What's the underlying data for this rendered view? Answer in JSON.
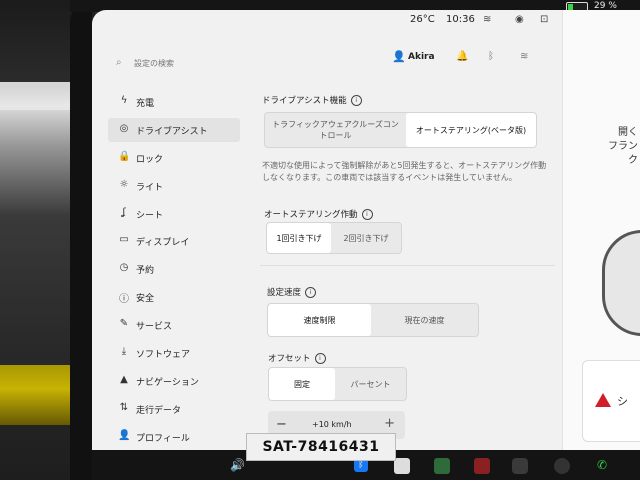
{
  "status_bar": {
    "temperature": "26°C",
    "time": "10:36",
    "battery_percent": "29 %",
    "battery_level": 0.29
  },
  "header": {
    "search_placeholder": "設定の検索",
    "user_name": "Akira"
  },
  "sidebar": {
    "items": [
      {
        "label": "充電",
        "icon": "bolt-icon",
        "glyph": "ϟ"
      },
      {
        "label": "ドライブアシスト",
        "icon": "steering-wheel-icon",
        "glyph": "◎",
        "active": true
      },
      {
        "label": "ロック",
        "icon": "lock-icon",
        "glyph": "🔒"
      },
      {
        "label": "ライト",
        "icon": "light-icon",
        "glyph": "☼"
      },
      {
        "label": "シート",
        "icon": "seat-icon",
        "glyph": "ʆ"
      },
      {
        "label": "ディスプレイ",
        "icon": "display-icon",
        "glyph": "▭"
      },
      {
        "label": "予約",
        "icon": "clock-icon",
        "glyph": "◷"
      },
      {
        "label": "安全",
        "icon": "safety-icon",
        "glyph": "ⓘ"
      },
      {
        "label": "サービス",
        "icon": "wrench-icon",
        "glyph": "✎"
      },
      {
        "label": "ソフトウェア",
        "icon": "download-icon",
        "glyph": "⤓"
      },
      {
        "label": "ナビゲーション",
        "icon": "navigation-icon",
        "glyph": "▲"
      },
      {
        "label": "走行データ",
        "icon": "trip-icon",
        "glyph": "⇅"
      },
      {
        "label": "プロフィール",
        "icon": "profile-icon",
        "glyph": "👤"
      }
    ]
  },
  "main": {
    "drive_assist": {
      "title": "ドライブアシスト機能",
      "options": [
        "トラフィックアウェアクルーズコントロール",
        "オートステアリング(ベータ版)"
      ],
      "selected": 1,
      "description": "不適切な使用によって強制解除があと5回発生すると、オートステアリング作動しなくなります。この車両では該当するイベントは発生していません。"
    },
    "autosteer_activation": {
      "title": "オートステアリング作動",
      "options": [
        "1回引き下げ",
        "2回引き下げ"
      ],
      "selected": 0
    },
    "set_speed": {
      "title": "設定速度",
      "options": [
        "速度制限",
        "現在の速度"
      ],
      "selected": 0
    },
    "offset": {
      "title": "オフセット",
      "options": [
        "固定",
        "パーセント"
      ],
      "selected": 0,
      "value": "+10 km/h"
    }
  },
  "right_panel": {
    "open_label": "開く",
    "frunk_label": "フランク",
    "alert_char": "シ"
  },
  "overlay_label": "SAT-78416431",
  "colors": {
    "screen_bg": "#f1f1f1",
    "selected_segment": "#ffffff",
    "alert_red": "#d01f2a",
    "bluetooth_blue": "#1877f2"
  }
}
